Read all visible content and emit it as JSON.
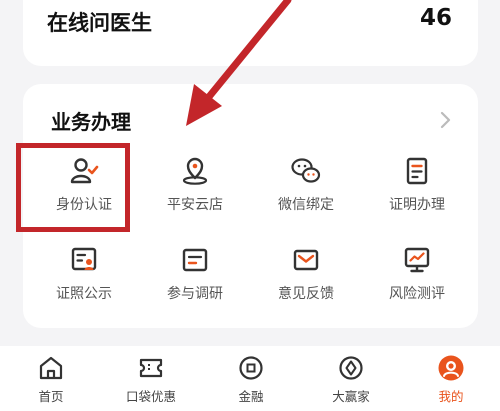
{
  "online_doctor": {
    "label": "在线问医生",
    "count": "46"
  },
  "business": {
    "title": "业务办理",
    "items": [
      {
        "label": "身份认证",
        "icon": "user-verify-icon"
      },
      {
        "label": "平安云店",
        "icon": "location-pin-icon"
      },
      {
        "label": "微信绑定",
        "icon": "wechat-icon"
      },
      {
        "label": "证明办理",
        "icon": "document-icon"
      },
      {
        "label": "证照公示",
        "icon": "license-icon"
      },
      {
        "label": "参与调研",
        "icon": "survey-icon"
      },
      {
        "label": "意见反馈",
        "icon": "envelope-icon"
      },
      {
        "label": "风险测评",
        "icon": "monitor-chart-icon"
      }
    ]
  },
  "tabbar": {
    "items": [
      {
        "label": "首页",
        "icon": "home-icon"
      },
      {
        "label": "口袋优惠",
        "icon": "coupon-icon"
      },
      {
        "label": "金融",
        "icon": "coin-icon"
      },
      {
        "label": "大赢家",
        "icon": "compass-icon"
      },
      {
        "label": "我的",
        "icon": "profile-icon",
        "active": true
      }
    ]
  },
  "colors": {
    "accent": "#e9541d",
    "highlight": "#c3262a",
    "icon": "#333333",
    "background": "#f4f4f6"
  }
}
